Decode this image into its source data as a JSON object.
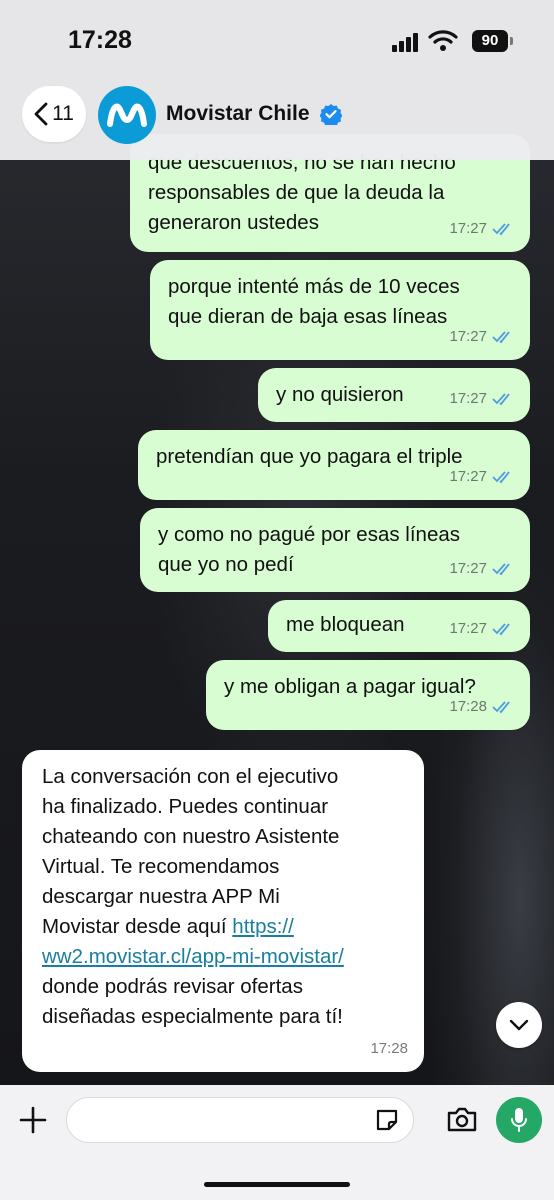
{
  "status_bar": {
    "time": "17:28",
    "battery": "90"
  },
  "header": {
    "back_count": "11",
    "contact_name": "Movistar Chile"
  },
  "messages": [
    {
      "direction": "out",
      "text": "que descuentos, no se han hecho\nresponsables de que la deuda la\ngeneraron ustedes",
      "time": "17:27"
    },
    {
      "direction": "out",
      "text": "porque intenté más de 10 veces\nque dieran de baja esas líneas",
      "time": "17:27"
    },
    {
      "direction": "out",
      "text": "y no quisieron",
      "time": "17:27"
    },
    {
      "direction": "out",
      "text": "pretendían que yo pagara el triple",
      "time": "17:27"
    },
    {
      "direction": "out",
      "text": "y como no pagué por esas líneas\nque yo no pedí",
      "time": "17:27"
    },
    {
      "direction": "out",
      "text": "me bloquean",
      "time": "17:27"
    },
    {
      "direction": "out",
      "text": "y me obligan a pagar igual?",
      "time": "17:28"
    },
    {
      "direction": "in",
      "text_before_link": "La conversación con el ejecutivo\nha finalizado. Puedes continuar\nchateando con nuestro Asistente\nVirtual. Te recomendamos\ndescargar nuestra APP Mi\nMovistar desde aquí ",
      "link_part1": "https://",
      "link_part2": "ww2.movistar.cl/app-mi-movistar/",
      "text_after_link": "donde podrás revisar ofertas\ndiseñadas especialmente para tí!",
      "time": "17:28"
    }
  ],
  "colors": {
    "outgoing_bubble": "#d9fdd3",
    "incoming_bubble": "#ffffff",
    "brand": "#0b9bd7",
    "mic": "#25a866",
    "read_ticks": "#4d9be0"
  }
}
